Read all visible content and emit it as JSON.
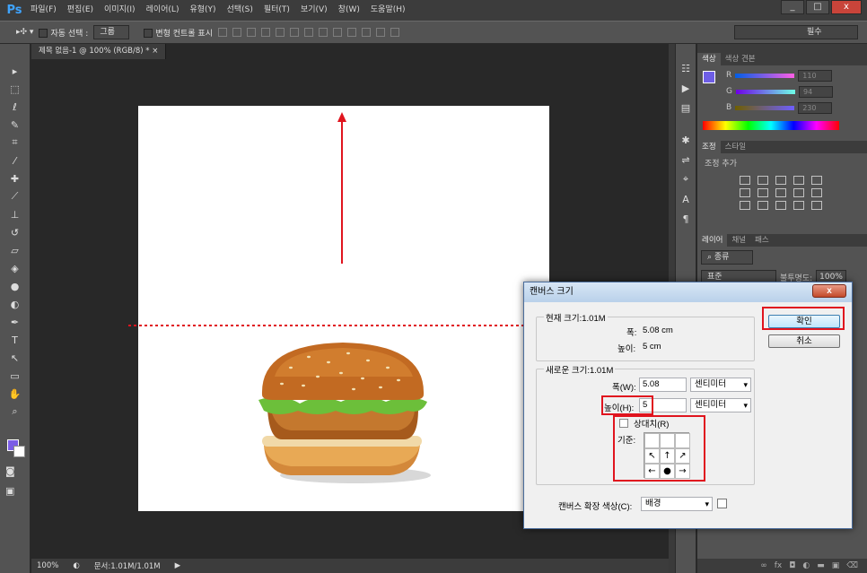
{
  "app": {
    "logo": "Ps",
    "menu": [
      "파일(F)",
      "편집(E)",
      "이미지(I)",
      "레이어(L)",
      "유형(Y)",
      "선택(S)",
      "필터(T)",
      "보기(V)",
      "창(W)",
      "도움말(H)"
    ],
    "window_controls": [
      "_",
      "□",
      "x"
    ]
  },
  "options": {
    "auto_select_label": "자동 선택 :",
    "auto_select_value": "그룹",
    "transform_controls_label": "변형 컨트롤 표시",
    "workspace": "필수"
  },
  "document": {
    "tab_title": "제목 없음-1 @ 100% (RGB/8) *",
    "zoom": "100%",
    "doc_size": "문서:1.01M/1.01M"
  },
  "color_panel": {
    "tabs": [
      "색상",
      "색상 견본"
    ],
    "r_label": "R",
    "g_label": "G",
    "b_label": "B",
    "r": "110",
    "g": "94",
    "b": "230",
    "foreground": "#6e5ee6"
  },
  "adjust_panel": {
    "tabs": [
      "조정",
      "스타일"
    ],
    "title": "조정 추가"
  },
  "layers_panel": {
    "tabs": [
      "레이어",
      "채널",
      "패스"
    ],
    "kind_label": "종류",
    "blend_mode": "표준",
    "opacity_label": "불투명도:",
    "opacity": "100%"
  },
  "dialog": {
    "title": "캔버스 크기",
    "close": "x",
    "current_size_label": "현재 크기:1.01M",
    "current_width_label": "폭:",
    "current_width_value": "5.08 cm",
    "current_height_label": "높이:",
    "current_height_value": "5 cm",
    "new_size_label": "새로운 크기:1.01M",
    "width_label": "폭(W):",
    "width_value": "5.08",
    "width_unit": "센티미터",
    "height_label": "높이(H):",
    "height_value": "5",
    "height_unit": "센티미터",
    "relative_label": "상대치(R)",
    "anchor_label": "기준:",
    "extension_color_label": "캔버스 확장 색상(C):",
    "extension_color_value": "배경",
    "ok_label": "확인",
    "cancel_label": "취소"
  },
  "annotation_color": "#e0141e"
}
